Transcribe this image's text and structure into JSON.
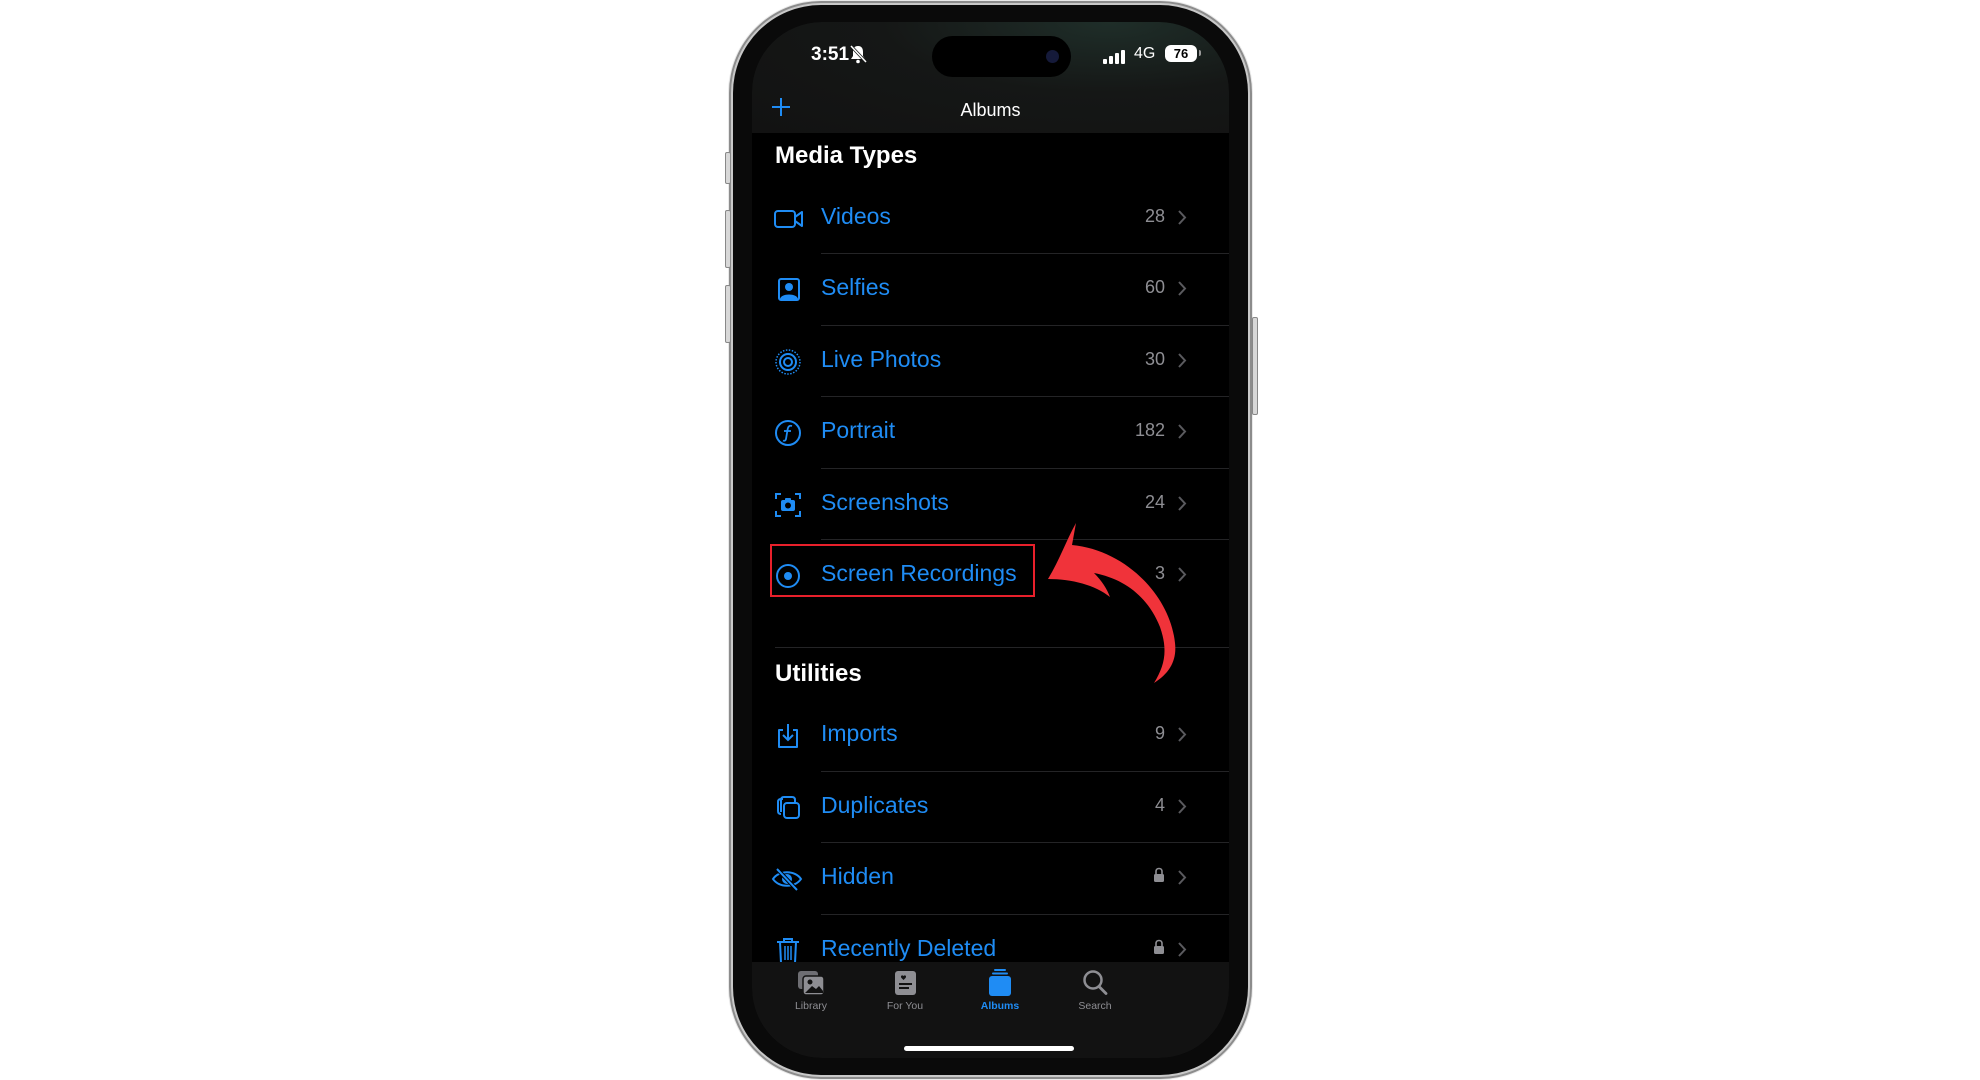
{
  "status_bar": {
    "time": "3:51",
    "network": "4G",
    "battery": "76",
    "silent_icon": "bell-slash-icon",
    "signal_icon": "cellular-signal-icon"
  },
  "nav": {
    "title": "Albums",
    "add_icon": "plus-icon"
  },
  "sections": [
    {
      "title": "Media Types",
      "items": [
        {
          "label": "Videos",
          "count": "28",
          "icon": "video-camera-icon"
        },
        {
          "label": "Selfies",
          "count": "60",
          "icon": "person-square-icon"
        },
        {
          "label": "Live Photos",
          "count": "30",
          "icon": "live-photo-icon"
        },
        {
          "label": "Portrait",
          "count": "182",
          "icon": "portrait-f-icon"
        },
        {
          "label": "Screenshots",
          "count": "24",
          "icon": "screenshot-icon"
        },
        {
          "label": "Screen Recordings",
          "count": "3",
          "icon": "record-circle-icon"
        }
      ]
    },
    {
      "title": "Utilities",
      "items": [
        {
          "label": "Imports",
          "count": "9",
          "icon": "import-tray-icon"
        },
        {
          "label": "Duplicates",
          "count": "4",
          "icon": "duplicate-squares-icon"
        },
        {
          "label": "Hidden",
          "count": "",
          "locked": true,
          "icon": "eye-slash-icon"
        },
        {
          "label": "Recently Deleted",
          "count": "",
          "locked": true,
          "icon": "trash-icon"
        }
      ]
    }
  ],
  "tabs": [
    {
      "label": "Library",
      "icon": "photo-library-icon",
      "active": false
    },
    {
      "label": "For You",
      "icon": "for-you-icon",
      "active": false
    },
    {
      "label": "Albums",
      "icon": "albums-stack-icon",
      "active": true
    },
    {
      "label": "Search",
      "icon": "search-icon",
      "active": false
    }
  ],
  "annotation": {
    "highlighted_item": "Screen Recordings",
    "color": "#e8202b"
  },
  "colors": {
    "accent": "#1f8cf4",
    "secondary_text": "#8e8e93",
    "annotation_red": "#f0333a"
  }
}
